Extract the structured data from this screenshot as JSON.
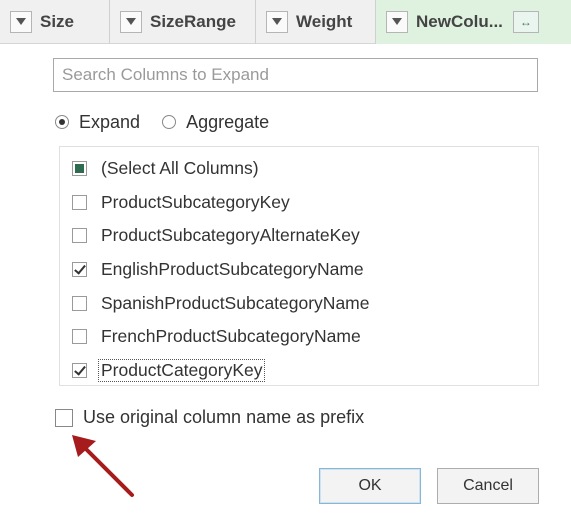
{
  "columns_header": [
    {
      "label": "Size",
      "highlight": false
    },
    {
      "label": "SizeRange",
      "highlight": false
    },
    {
      "label": "Weight",
      "highlight": false
    },
    {
      "label": "NewColu...",
      "highlight": true
    }
  ],
  "search": {
    "placeholder": "Search Columns to Expand",
    "value": ""
  },
  "mode": {
    "options": [
      {
        "label": "Expand",
        "selected": true
      },
      {
        "label": "Aggregate",
        "selected": false
      }
    ]
  },
  "column_list": [
    {
      "label": "(Select All Columns)",
      "state": "partial"
    },
    {
      "label": "ProductSubcategoryKey",
      "state": "unchecked"
    },
    {
      "label": "ProductSubcategoryAlternateKey",
      "state": "unchecked"
    },
    {
      "label": "EnglishProductSubcategoryName",
      "state": "checked"
    },
    {
      "label": "SpanishProductSubcategoryName",
      "state": "unchecked"
    },
    {
      "label": "FrenchProductSubcategoryName",
      "state": "unchecked"
    },
    {
      "label": "ProductCategoryKey",
      "state": "checked",
      "focused": true
    }
  ],
  "prefix_option": {
    "label": "Use original column name as prefix",
    "checked": false
  },
  "buttons": {
    "ok": "OK",
    "cancel": "Cancel"
  },
  "colors": {
    "arrow": "#a61b1b",
    "select_all_fill": "#2e6b4f",
    "new_column_bg": "#dff2df"
  }
}
